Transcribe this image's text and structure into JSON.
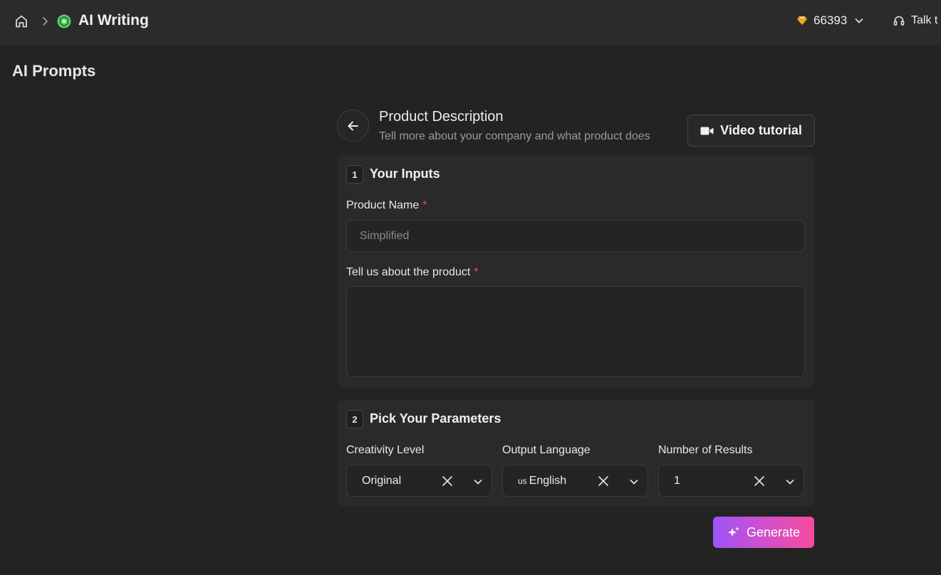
{
  "header": {
    "app_title": "AI Writing",
    "credits": "66393",
    "support_label": "Talk t"
  },
  "page": {
    "heading": "AI Prompts"
  },
  "tool": {
    "title": "Product Description",
    "subtitle": "Tell more about your company and what product does",
    "video_label": "Video tutorial"
  },
  "inputs_card": {
    "step": "1",
    "title": "Your Inputs",
    "product_name_label": "Product Name",
    "product_name_placeholder": "Simplified",
    "product_name_value": "",
    "about_label": "Tell us about the product",
    "about_value": "",
    "required_mark": "*"
  },
  "params_card": {
    "step": "2",
    "title": "Pick Your Parameters",
    "params": [
      {
        "label": "Creativity Level",
        "value": "Original"
      },
      {
        "label": "Output Language",
        "flag": "us",
        "value": "English"
      },
      {
        "label": "Number of Results",
        "value": "1"
      }
    ]
  },
  "actions": {
    "generate_label": "Generate"
  },
  "colors": {
    "accent_gradient_start": "#9b54f7",
    "accent_gradient_end": "#f64b9c",
    "required": "#f04b4b",
    "gem": "#f5a623"
  }
}
